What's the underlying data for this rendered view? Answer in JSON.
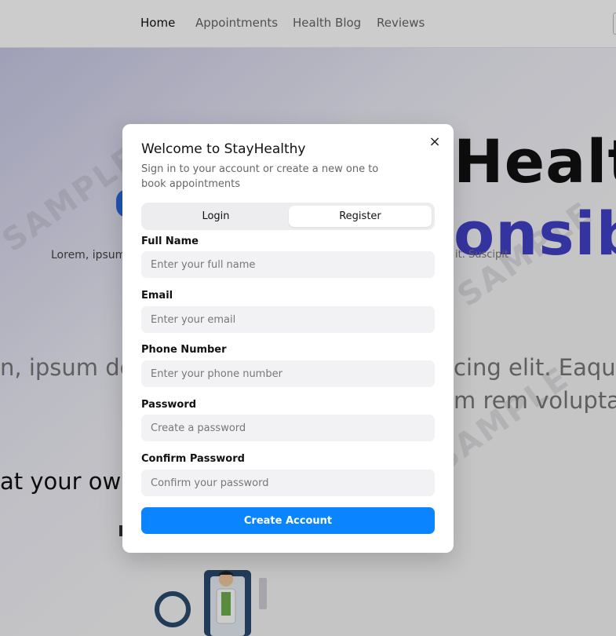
{
  "nav": {
    "items": [
      {
        "label": "Home",
        "active": true
      },
      {
        "label": "Appointments",
        "active": false
      },
      {
        "label": "Health Blog",
        "active": false
      },
      {
        "label": "Reviews",
        "active": false
      }
    ]
  },
  "hero": {
    "title_line1": "Health",
    "title_line2": "onsib",
    "subtitle_left": "Lorem, ipsum",
    "subtitle_right": "it. Suscipit",
    "body_left": "n, ipsum do",
    "body_right_1": "cing elit. Eaque",
    "body_right_2": "m rem voluptat",
    "pace_text": "at your own",
    "watermark": "SAMPLE"
  },
  "modal": {
    "title": "Welcome to StayHealthy",
    "description": "Sign in to your account or create a new one to book appointments",
    "close_icon": "×",
    "tabs": [
      {
        "label": "Login",
        "active": false
      },
      {
        "label": "Register",
        "active": true
      }
    ],
    "fields": [
      {
        "label": "Full Name",
        "placeholder": "Enter your full name",
        "value": ""
      },
      {
        "label": "Email",
        "placeholder": "Enter your email",
        "value": ""
      },
      {
        "label": "Phone Number",
        "placeholder": "Enter your phone number",
        "value": ""
      },
      {
        "label": "Password",
        "placeholder": "Create a password",
        "value": ""
      },
      {
        "label": "Confirm Password",
        "placeholder": "Confirm your password",
        "value": ""
      }
    ],
    "submit_label": "Create Account"
  },
  "colors": {
    "primary": "#0a84ff",
    "hero_accent": "#4242c9"
  }
}
